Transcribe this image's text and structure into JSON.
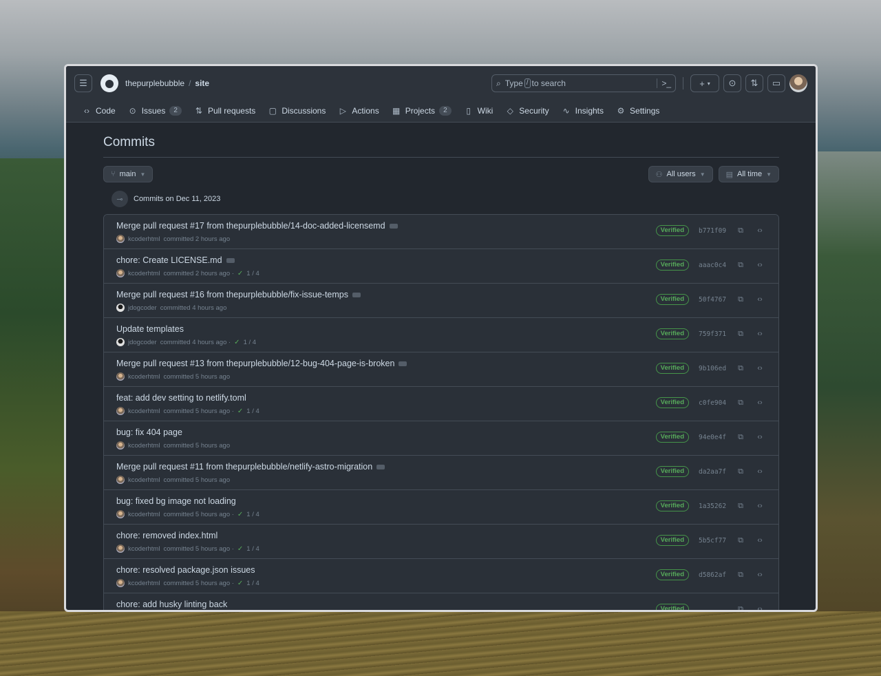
{
  "header": {
    "owner": "thepurplebubble",
    "separator": "/",
    "repo": "site",
    "search_prefix": "Type",
    "search_key": "/",
    "search_suffix": "to search",
    "search_cmd": ">_",
    "plus": "+",
    "caret": "▾"
  },
  "nav": {
    "code": "Code",
    "issues": "Issues",
    "issues_count": "2",
    "pulls": "Pull requests",
    "discussions": "Discussions",
    "actions": "Actions",
    "projects": "Projects",
    "projects_count": "2",
    "wiki": "Wiki",
    "security": "Security",
    "insights": "Insights",
    "settings": "Settings"
  },
  "page": {
    "title": "Commits",
    "branch": "main",
    "users_filter": "All users",
    "time_filter": "All time",
    "date_heading": "Commits on Dec 11, 2023"
  },
  "commits": [
    {
      "title": "Merge pull request #17 from thepurplebubble/14-doc-added-licensemd",
      "author": "kcoderhtml",
      "time": "committed 2 hours ago",
      "checks": "",
      "verified": "Verified",
      "sha": "b771f09"
    },
    {
      "title": "chore: Create LICENSE.md",
      "author": "kcoderhtml",
      "time": "committed 2 hours ago ·",
      "checks": "1 / 4",
      "verified": "Verified",
      "sha": "aaac0c4"
    },
    {
      "title": "Merge pull request #16 from thepurplebubble/fix-issue-temps",
      "author": "jdogcoder",
      "time": "committed 4 hours ago",
      "checks": "",
      "verified": "Verified",
      "sha": "50f4767"
    },
    {
      "title": "Update templates",
      "author": "jdogcoder",
      "time": "committed 4 hours ago ·",
      "checks": "1 / 4",
      "verified": "Verified",
      "sha": "759f371"
    },
    {
      "title": "Merge pull request #13 from thepurplebubble/12-bug-404-page-is-broken",
      "author": "kcoderhtml",
      "time": "committed 5 hours ago",
      "checks": "",
      "verified": "Verified",
      "sha": "9b106ed"
    },
    {
      "title": "feat: add dev setting to netlify.toml",
      "author": "kcoderhtml",
      "time": "committed 5 hours ago ·",
      "checks": "1 / 4",
      "verified": "Verified",
      "sha": "c0fe904"
    },
    {
      "title": "bug: fix 404 page",
      "author": "kcoderhtml",
      "time": "committed 5 hours ago",
      "checks": "",
      "verified": "Verified",
      "sha": "94e0e4f"
    },
    {
      "title": "Merge pull request #11 from thepurplebubble/netlify-astro-migration",
      "author": "kcoderhtml",
      "time": "committed 5 hours ago",
      "checks": "",
      "verified": "Verified",
      "sha": "da2aa7f"
    },
    {
      "title": "bug: fixed bg image not loading",
      "author": "kcoderhtml",
      "time": "committed 5 hours ago ·",
      "checks": "1 / 4",
      "verified": "Verified",
      "sha": "1a35262"
    },
    {
      "title": "chore: removed index.html",
      "author": "kcoderhtml",
      "time": "committed 5 hours ago ·",
      "checks": "1 / 4",
      "verified": "Verified",
      "sha": "5b5cf77"
    },
    {
      "title": "chore: resolved package.json issues",
      "author": "kcoderhtml",
      "time": "committed 5 hours ago ·",
      "checks": "1 / 4",
      "verified": "Verified",
      "sha": "d5862af"
    },
    {
      "title": "chore: add husky linting back",
      "author": "",
      "time": "",
      "checks": "",
      "verified": "Verified",
      "sha": ""
    }
  ]
}
